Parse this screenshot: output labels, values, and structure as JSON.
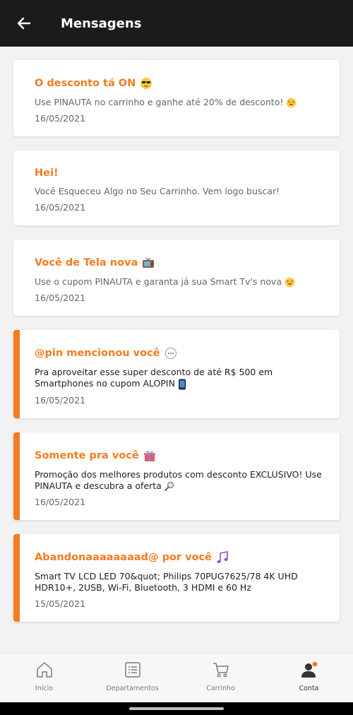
{
  "header": {
    "title": "Mensagens"
  },
  "colors": {
    "accent": "#f47b20",
    "topbar": "#1b1b1b"
  },
  "messages": [
    {
      "title": "O desconto tá ON",
      "emoji_icon": "sunglasses-emoji",
      "text": "Use PINAUTA no carrinho e ganhe até 20% de desconto!",
      "text_emoji": "heart-eyes-emoji",
      "date": "16/05/2021",
      "unread": false
    },
    {
      "title": "Hei!",
      "text": "Você Esqueceu Algo no Seu Carrinho. Vem logo buscar!",
      "date": "16/05/2021",
      "unread": false
    },
    {
      "title": "Você de Tela nova",
      "emoji_icon": "tv-emoji",
      "text": "Use o cupom PINAUTA e garanta já sua Smart Tv's nova",
      "text_emoji": "heart-eyes-emoji",
      "date": "16/05/2021",
      "unread": false
    },
    {
      "title": "@pin mencionou você",
      "emoji_icon": "speech-bubble-emoji",
      "text": "Pra aproveitar esse super desconto de até R$ 500 em Smartphones no cupom ALOPIN",
      "text_emoji": "phone-emoji",
      "date": "16/05/2021",
      "unread": true
    },
    {
      "title": "Somente pra você",
      "emoji_icon": "gift-emoji",
      "text": "Promoção dos melhores produtos com desconto EXCLUSIVO! Use PINAUTA e descubra a oferta",
      "text_emoji": "magnifier-emoji",
      "date": "16/05/2021",
      "unread": true
    },
    {
      "title": "Abandonaaaaaaaad@ por você",
      "emoji_icon": "music-notes-emoji",
      "text": "Smart TV LCD LED 70&quot; Philips 70PUG7625/78 4K UHD HDR10+, 2USB, Wi-Fi, Bluetooth, 3 HDMI e 60 Hz",
      "date": "15/05/2021",
      "unread": true
    }
  ],
  "nav": [
    {
      "label": "Início",
      "icon": "home-icon"
    },
    {
      "label": "Departamentos",
      "icon": "list-icon"
    },
    {
      "label": "Carrinho",
      "icon": "cart-icon"
    },
    {
      "label": "Conta",
      "icon": "user-icon",
      "active": true
    }
  ]
}
